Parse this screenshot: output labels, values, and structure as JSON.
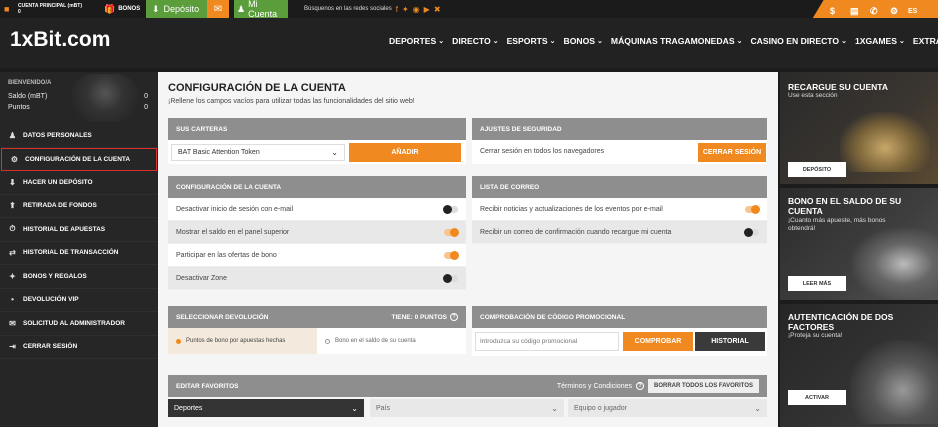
{
  "topbar": {
    "account_label": "CUENTA PRINCIPAL (mBT)",
    "account_value": "0",
    "bonos": "BONOS",
    "deposito": "Depósito",
    "mi_cuenta": "Mi Cuenta",
    "social_text": "Búsquenos en las redes sociales",
    "lang": "ES"
  },
  "header": {
    "logo": "1xBit.com",
    "nav": [
      "DEPORTES",
      "DIRECTO",
      "ESPORTS",
      "BONOS",
      "MÁQUINAS TRAGAMONEDAS",
      "CASINO EN DIRECTO",
      "1XGAMES",
      "EXTRA"
    ]
  },
  "sidebar": {
    "welcome": "BIENVENIDO/A",
    "saldo_label": "Saldo (mBT)",
    "saldo_value": "0",
    "puntos_label": "Puntos",
    "puntos_value": "0",
    "items": [
      {
        "label": "DATOS PERSONALES",
        "icon": "user-icon"
      },
      {
        "label": "CONFIGURACIÓN DE LA CUENTA",
        "icon": "gears-icon"
      },
      {
        "label": "HACER UN DEPÓSITO",
        "icon": "deposit-icon"
      },
      {
        "label": "RETIRADA DE FONDOS",
        "icon": "withdraw-icon"
      },
      {
        "label": "HISTORIAL DE APUESTAS",
        "icon": "history-icon"
      },
      {
        "label": "HISTORIAL DE TRANSACCIÓN",
        "icon": "transactions-icon"
      },
      {
        "label": "BONOS Y REGALOS",
        "icon": "gift-icon"
      },
      {
        "label": "DEVOLUCIÓN VIP",
        "icon": "dot-icon"
      },
      {
        "label": "SOLICITUD AL ADMINISTRADOR",
        "icon": "mail-icon"
      },
      {
        "label": "CERRAR SESIÓN",
        "icon": "logout-icon"
      }
    ]
  },
  "main": {
    "title": "CONFIGURACIÓN DE LA CUENTA",
    "subtitle": "¡Rellene los campos vacíos para utilizar todas las funcionalidades del sitio web!",
    "carteras": {
      "header": "SUS CARTERAS",
      "select": "BAT Basic Attention Token",
      "button": "AÑADIR"
    },
    "seguridad": {
      "header": "AJUSTES DE SEGURIDAD",
      "text": "Cerrar sesión en todos los navegadores",
      "button": "CERRAR SESIÓN"
    },
    "config": {
      "header": "CONFIGURACIÓN DE LA CUENTA",
      "rows": [
        {
          "label": "Desactivar inicio de sesión con e-mail",
          "on": false
        },
        {
          "label": "Mostrar el saldo en el panel superior",
          "on": true
        },
        {
          "label": "Participar en las ofertas de bono",
          "on": true
        },
        {
          "label": "Desactivar Zone",
          "on": false
        }
      ]
    },
    "correo": {
      "header": "LISTA DE CORREO",
      "rows": [
        {
          "label": "Recibir noticias y actualizaciones de los eventos por e-mail",
          "on": true
        },
        {
          "label": "Recibir un correo de confirmación cuando recargue mi cuenta",
          "on": false
        }
      ]
    },
    "devolucion": {
      "header": "SELECCIONAR DEVOLUCIÓN",
      "tiene": "TIENE: 0 PUNTOS",
      "opt1": "Puntos de bono por apuestas hechas",
      "opt2": "Bono en el saldo de su cuenta"
    },
    "promo": {
      "header": "COMPROBACIÓN DE CÓDIGO PROMOCIONAL",
      "placeholder": "Introduzca su código promocional",
      "check": "COMPROBAR",
      "history": "HISTORIAL"
    },
    "favoritos": {
      "header": "EDITAR FAVORITOS",
      "terms": "Términos y Condiciones",
      "clear": "BORRAR TODOS LOS FAVORITOS",
      "sel1": "Deportes",
      "sel2": "País",
      "sel3": "Equipo o jugador"
    }
  },
  "right": {
    "c1_title": "RECARGUE SU CUENTA",
    "c1_sub": "Use esta sección",
    "c1_btn": "DEPÓSITO",
    "c2_title": "BONO EN EL SALDO DE SU CUENTA",
    "c2_sub": "¡Cuanto más apueste, más bonos obtendrá!",
    "c2_btn": "LEER MÁS",
    "c3_title": "AUTENTICACIÓN DE DOS FACTORES",
    "c3_sub": "¡Proteja su cuenta!",
    "c3_btn": "ACTIVAR"
  },
  "colors": {
    "accent": "#f0891f",
    "green": "#5b9c3b",
    "dark": "#222222",
    "active_border": "#d9302b"
  }
}
